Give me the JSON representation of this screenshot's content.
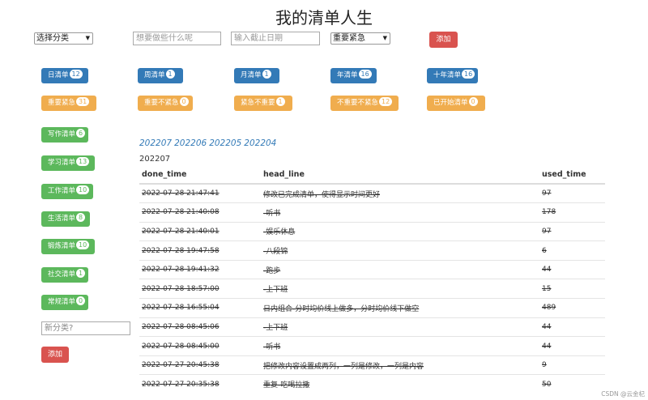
{
  "title": "我的清单人生",
  "form": {
    "category_select": "选择分类",
    "task_placeholder": "想要做些什么呢",
    "deadline_placeholder": "输入截止日期",
    "priority_select": "重要紧急",
    "add_label": "添加"
  },
  "period_lists": [
    {
      "label": "日清单",
      "count": "12"
    },
    {
      "label": "周清单",
      "count": "1"
    },
    {
      "label": "月清单",
      "count": "1"
    },
    {
      "label": "年清单",
      "count": "16"
    },
    {
      "label": "十年清单",
      "count": "16"
    }
  ],
  "priority_lists": [
    {
      "label": "重要紧急",
      "count": "31"
    },
    {
      "label": "重要不紧急",
      "count": "0"
    },
    {
      "label": "紧急不重要",
      "count": "1"
    },
    {
      "label": "不重要不紧急",
      "count": "12"
    },
    {
      "label": "已开始清单",
      "count": "0"
    }
  ],
  "category_lists": [
    {
      "label": "写作清单",
      "count": "6"
    },
    {
      "label": "学习清单",
      "count": "13"
    },
    {
      "label": "工作清单",
      "count": "10"
    },
    {
      "label": "生活清单",
      "count": "8"
    },
    {
      "label": "锻炼清单",
      "count": "10"
    },
    {
      "label": "社交清单",
      "count": "1"
    },
    {
      "label": "常规清单",
      "count": "0"
    }
  ],
  "new_category": {
    "placeholder": "新分类?",
    "add_label": "添加"
  },
  "months": [
    "202207",
    "202206",
    "202205",
    "202204"
  ],
  "current_month": "202207",
  "table": {
    "headers": [
      "done_time",
      "head_line",
      "used_time"
    ],
    "rows": [
      [
        "2022-07-28 21:47:41",
        "修改已完成清单，使得显示时间更好",
        "97"
      ],
      [
        "2022-07-28 21:40:08",
        "-听书",
        "178"
      ],
      [
        "2022-07-28 21:40:01",
        "-娱乐休息",
        "97"
      ],
      [
        "2022-07-28 19:47:58",
        "-八段锦",
        "6"
      ],
      [
        "2022-07-28 19:41:32",
        "-跑步",
        "44"
      ],
      [
        "2022-07-28 18:57:00",
        "-上下班",
        "15"
      ],
      [
        "2022-07-28 16:55:04",
        "日内组合-分时均价线上做多，分时均价线下做空",
        "489"
      ],
      [
        "2022-07-28 08:45:06",
        "-上下班",
        "44"
      ],
      [
        "2022-07-28 08:45:00",
        "-听书",
        "44"
      ],
      [
        "2022-07-27 20:45:38",
        "把修改内容设置成两列，一列是修改，一列是内容",
        "9"
      ],
      [
        "2022-07-27 20:35:38",
        "重复-吃喝拉撒",
        "50"
      ]
    ]
  },
  "watermark": "CSDN @云金杞"
}
